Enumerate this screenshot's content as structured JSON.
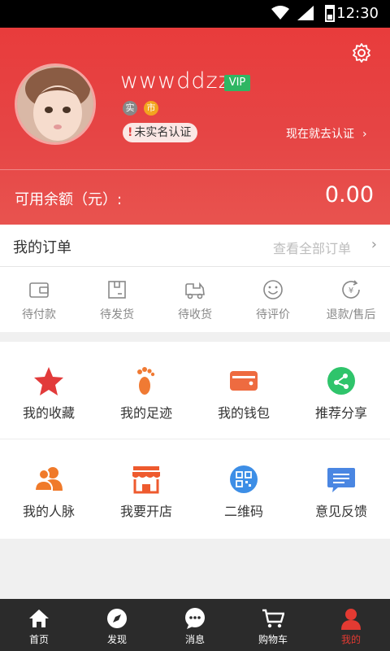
{
  "status_bar": {
    "time": "12:30"
  },
  "profile": {
    "username": "wwwddzz",
    "vip_label": "VIP",
    "tag_real": "实",
    "tag_city": "市",
    "verify_status": "未实名认证",
    "verify_link": "现在就去认证",
    "balance_label": "可用余额（元）:",
    "balance_value": "0.00"
  },
  "orders": {
    "title": "我的订单",
    "view_all": "查看全部订单",
    "statuses": [
      {
        "label": "待付款",
        "icon": "wallet-icon"
      },
      {
        "label": "待发货",
        "icon": "package-icon"
      },
      {
        "label": "待收货",
        "icon": "truck-icon"
      },
      {
        "label": "待评价",
        "icon": "smiley-icon"
      },
      {
        "label": "退款/售后",
        "icon": "refund-icon"
      }
    ]
  },
  "grid": [
    {
      "label": "我的收藏",
      "icon": "star-icon",
      "color": "#e23b3b"
    },
    {
      "label": "我的足迹",
      "icon": "footprint-icon",
      "color": "#f07a33"
    },
    {
      "label": "我的钱包",
      "icon": "wallet-icon",
      "color": "#ee6b40"
    },
    {
      "label": "推荐分享",
      "icon": "share-icon",
      "color": "#2fc46b"
    },
    {
      "label": "我的人脉",
      "icon": "contacts-icon",
      "color": "#f07a2a"
    },
    {
      "label": "我要开店",
      "icon": "store-icon",
      "color": "#ee5a2e"
    },
    {
      "label": "二维码",
      "icon": "qrcode-icon",
      "color": "#3d8ee6"
    },
    {
      "label": "意见反馈",
      "icon": "feedback-icon",
      "color": "#4a86e2"
    }
  ],
  "tabs": [
    {
      "label": "首页",
      "icon": "home-icon"
    },
    {
      "label": "发现",
      "icon": "compass-icon"
    },
    {
      "label": "消息",
      "icon": "message-icon"
    },
    {
      "label": "购物车",
      "icon": "cart-icon"
    },
    {
      "label": "我的",
      "icon": "user-icon",
      "active": true
    }
  ],
  "colors": {
    "header": "#e64545",
    "active_tab": "#e33a32",
    "tabbar": "#2b2b2b"
  }
}
